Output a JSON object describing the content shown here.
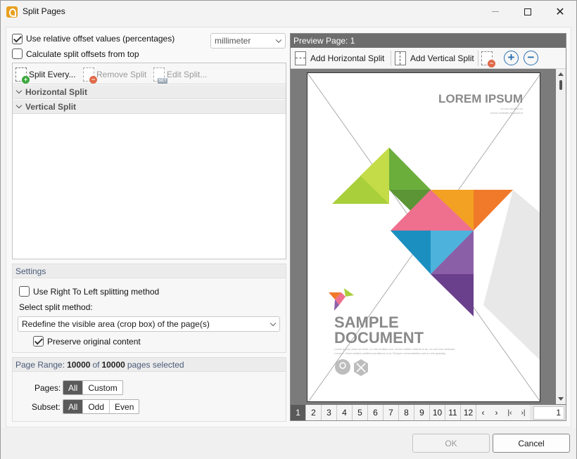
{
  "window": {
    "title": "Split Pages"
  },
  "options": {
    "relative_label": "Use relative offset values (percentages)",
    "relative_checked": true,
    "from_top_label": "Calculate split offsets from top",
    "from_top_checked": false,
    "unit_value": "millimeter"
  },
  "split_toolbar": {
    "split_every": "Split Every...",
    "remove_split": "Remove Split",
    "edit_split": "Edit Split..."
  },
  "split_groups": [
    "Horizontal Split",
    "Vertical Split"
  ],
  "settings": {
    "header": "Settings",
    "rtl_label": "Use Right To Left splitting method",
    "rtl_checked": false,
    "method_label": "Select split method:",
    "method_value": "Redefine the visible area (crop box) of the page(s)",
    "preserve_label": "Preserve original content",
    "preserve_checked": true
  },
  "page_range": {
    "prefix": "Page Range:",
    "selected": "10000",
    "of": "of",
    "total": "10000",
    "suffix": "pages selected",
    "pages_label": "Pages:",
    "pages_options": [
      "All",
      "Custom"
    ],
    "subset_label": "Subset:",
    "subset_options": [
      "All",
      "Odd",
      "Even"
    ]
  },
  "preview": {
    "header": "Preview Page: 1",
    "add_horizontal": "Add Horizontal Split",
    "add_vertical": "Add Vertical Split",
    "zoom_in": "+",
    "zoom_out": "−",
    "doc_title": "LOREM IPSUM",
    "doc_sub1": "ex nec facilisis eu",
    "doc_sub2": "lorem molestie placerat et",
    "doc_heading1": "SAMPLE",
    "doc_heading2": "DOCUMENT",
    "doc_body1": "Lorem ipsum dolor sit amet, ex ulet facilisis aon, lorem maltem deterilt in au, ex cet eros delecast",
    "doc_body2": "Lonrum. Nemi anribue petitiret pertatuum a at. Semper consonstelitus aet au wer grandig.",
    "pages": [
      "1",
      "2",
      "3",
      "4",
      "5",
      "6",
      "7",
      "8",
      "9",
      "10",
      "11",
      "12"
    ],
    "active_page": "1",
    "nav_prev": "‹",
    "nav_next": "›",
    "nav_first": "|‹",
    "nav_last": "›|",
    "page_input": "1"
  },
  "footer": {
    "ok": "OK",
    "cancel": "Cancel"
  },
  "colors": {
    "accent_blue": "#2a6fb0",
    "selected_segment": "#5a5a5a",
    "preview_bg": "#7b7b7b"
  }
}
